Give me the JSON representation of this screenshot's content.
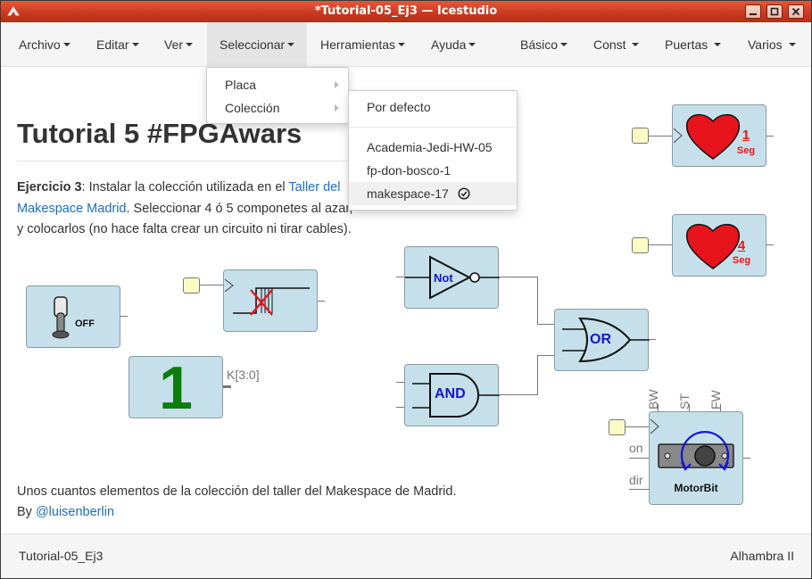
{
  "window": {
    "title": "*Tutorial-05_Ej3 — Icestudio"
  },
  "menubar": {
    "items": [
      {
        "label": "Archivo"
      },
      {
        "label": "Editar"
      },
      {
        "label": "Ver"
      },
      {
        "label": "Seleccionar"
      },
      {
        "label": "Herramientas"
      },
      {
        "label": "Ayuda"
      },
      {
        "label": "Básico"
      },
      {
        "label": "Const"
      },
      {
        "label": "Puertas"
      },
      {
        "label": "Varios"
      }
    ]
  },
  "seleccionar_menu": {
    "items": [
      {
        "label": "Placa"
      },
      {
        "label": "Colección"
      }
    ]
  },
  "coleccion_submenu": {
    "items": [
      {
        "label": "Por defecto"
      },
      {
        "label": "Academia-Jedi-HW-05"
      },
      {
        "label": "fp-don-bosco-1"
      },
      {
        "label": "makespace-17",
        "selected": true
      }
    ]
  },
  "document": {
    "heading": "Tutorial 5 #FPGAwars",
    "p_bold": "Ejercicio 3",
    "p_text1": ": Instalar la colección utilizada en el ",
    "p_link": "Taller del Makespace Madrid",
    "p_text2": ". Seleccionar 4 ó 5 componetes al azar, y colocarlos (no hace falta crear un circuito ni tirar cables).",
    "footer_line1": "Unos cuantos elementos de la colección del taller del Makespace de Madrid.",
    "footer_by": "By ",
    "footer_link": "@luisenberlin"
  },
  "blocks": {
    "switch_label": "OFF",
    "display_digit": "1",
    "display_port": "K[3:0]",
    "not_label": "Not",
    "and_label": "AND",
    "or_label": "OR",
    "heart1_num": "1",
    "heart1_unit": "Seg",
    "heart4_num": "4",
    "heart4_unit": "Seg",
    "motor_label": "MotorBit",
    "motor_in_on": "on",
    "motor_in_dir": "dir",
    "motor_top": [
      "BW",
      "ST",
      "FW"
    ]
  },
  "statusbar": {
    "file": "Tutorial-05_Ej3",
    "board": "Alhambra II"
  },
  "colors": {
    "titlebar": "#c8381f",
    "block_fill": "#c5e0ea",
    "link": "#1d6fc2",
    "heart": "#e8141c",
    "digit": "#0b7d0b",
    "gate_text": "#1515d0"
  }
}
